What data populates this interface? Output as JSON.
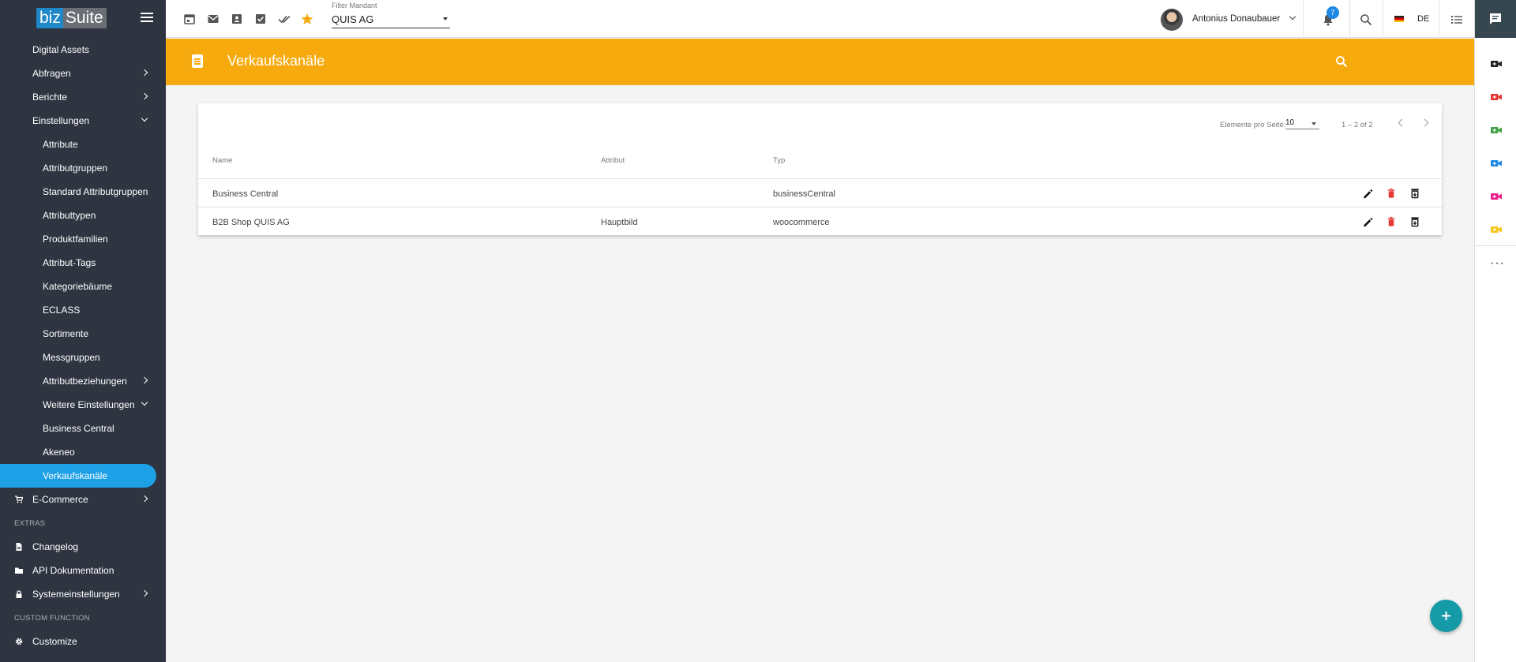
{
  "sidebar": {
    "logo": {
      "left": "biz",
      "right": "Suite"
    },
    "items": [
      {
        "label": "Digital Assets",
        "level": 0
      },
      {
        "label": "Abfragen",
        "level": 0,
        "chevron": "right"
      },
      {
        "label": "Berichte",
        "level": 0,
        "chevron": "right"
      },
      {
        "label": "Einstellungen",
        "level": 0,
        "chevron": "down"
      },
      {
        "label": "Attribute",
        "level": 1
      },
      {
        "label": "Attributgruppen",
        "level": 1
      },
      {
        "label": "Standard Attributgruppen",
        "level": 1
      },
      {
        "label": "Attributtypen",
        "level": 1
      },
      {
        "label": "Produktfamilien",
        "level": 1
      },
      {
        "label": "Attribut-Tags",
        "level": 1
      },
      {
        "label": "Kategoriebäume",
        "level": 1
      },
      {
        "label": "ECLASS",
        "level": 1
      },
      {
        "label": "Sortimente",
        "level": 1
      },
      {
        "label": "Messgruppen",
        "level": 1
      },
      {
        "label": "Attributbeziehungen",
        "level": 1,
        "chevron": "right"
      },
      {
        "label": "Weitere Einstellungen",
        "level": 1,
        "chevron": "down"
      },
      {
        "label": "Business Central",
        "level": 1
      },
      {
        "label": "Akeneo",
        "level": 1
      },
      {
        "label": "Verkaufskanäle",
        "level": 1,
        "active": true
      },
      {
        "label": "E-Commerce",
        "level": 0,
        "chevron": "right",
        "icon": "cart-icon"
      }
    ],
    "extras_label": "EXTRAS",
    "extras": [
      {
        "label": "Changelog",
        "icon": "document-icon"
      },
      {
        "label": "API Dokumentation",
        "icon": "folder-icon"
      },
      {
        "label": "Systemeinstellungen",
        "icon": "lock-icon",
        "chevron": "right"
      }
    ],
    "custom_label": "CUSTOM FUNCTION",
    "custom": [
      {
        "label": "Customize",
        "icon": "gear-icon"
      }
    ]
  },
  "topbar": {
    "icons": [
      "calendar-icon",
      "mail-icon",
      "contact-icon",
      "checkbox-icon",
      "double-check-icon",
      "star-icon"
    ],
    "filter_label": "Filter Mandant",
    "filter_value": "QUIS AG",
    "user_name": "Antonius Donaubauer",
    "notifications": "7",
    "language": "DE"
  },
  "header": {
    "title": "Verkaufskanäle"
  },
  "table": {
    "per_page_label": "Elemente pro Seite:",
    "per_page_value": "10",
    "range": "1 – 2 of 2",
    "columns": {
      "name": "Name",
      "attribute": "Attribut",
      "type": "Typ"
    },
    "rows": [
      {
        "name": "Business Central",
        "attribute": "",
        "type": "businessCentral"
      },
      {
        "name": "B2B Shop QUIS AG",
        "attribute": "Hauptbild",
        "type": "woocommerce"
      }
    ]
  },
  "colors": {
    "accent": "#f6aa0d",
    "sidebar": "#2e3440",
    "active": "#1ea0e6",
    "fab": "#159aa8",
    "delete": "#e53935"
  },
  "rail": {
    "video_colors": [
      "#222222",
      "#e53935",
      "#43a047",
      "#1e88e5",
      "#e91e8c",
      "#f5c518"
    ]
  }
}
